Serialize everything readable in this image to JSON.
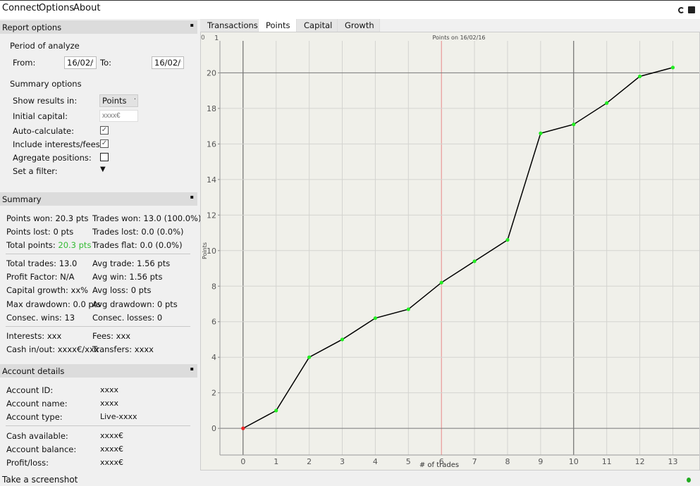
{
  "menu": {
    "connect": "Connect",
    "options": "Options",
    "about": "About",
    "icons": [
      "refresh-icon",
      "camera-icon"
    ]
  },
  "report": {
    "title": "Report options",
    "period": "Period of analyze",
    "from_label": "From:",
    "from_value": "16/02/",
    "to_label": "To:",
    "to_value": "16/02/",
    "summary_options": "Summary options",
    "show_results_label": "Show results in:",
    "show_results_value": "Points",
    "initial_capital_label": "Initial capital:",
    "initial_capital_placeholder": "xxxx€",
    "auto_calc_label": "Auto-calculate:",
    "auto_calc": true,
    "include_fees_label": "Include interests/fees:",
    "include_fees": true,
    "aggregate_label": "Agregate positions:",
    "aggregate": false,
    "filter_label": "Set a filter:"
  },
  "summary": {
    "title": "Summary",
    "points_won_label": "Points won:",
    "points_won": "20.3 pts",
    "trades_won": "Trades won: 13.0 (100.0%)",
    "points_lost": "Points lost: 0 pts",
    "trades_lost": "Trades lost: 0.0 (0.0%)",
    "total_points_label": "Total points:",
    "total_points": "20.3 pts",
    "trades_flat": "Trades flat: 0.0 (0.0%)",
    "total_trades": "Total trades: 13.0",
    "avg_trade": "Avg trade: 1.56 pts",
    "profit_factor": "Profit Factor: N/A",
    "avg_win": "Avg win: 1.56 pts",
    "capital_growth": "Capital growth: xx%",
    "avg_loss": "Avg loss: 0 pts",
    "max_drawdown": "Max drawdown: 0.0 pts",
    "avg_drawdown": "Avg drawdown: 0 pts",
    "consec_wins": "Consec. wins: 13",
    "consec_losses": "Consec. losses: 0",
    "interests": "Interests: xxx",
    "fees": "Fees: xxx",
    "cash_inout": "Cash in/out: xxxx€/xxx",
    "transfers": "Transfers: xxxx",
    "positive_color": "#33bb33"
  },
  "account": {
    "title": "Account details",
    "rows": [
      {
        "label": "Account ID:",
        "value": "xxxx"
      },
      {
        "label": "Account name:",
        "value": "xxxx"
      },
      {
        "label": "Account type:",
        "value": "Live-xxxx"
      },
      {
        "label": "Cash available:",
        "value": "xxxx€"
      },
      {
        "label": "Account balance:",
        "value": "xxxx€"
      },
      {
        "label": "Profit/loss:",
        "value": "xxxx€"
      }
    ]
  },
  "tabs": [
    {
      "label": "Transactions"
    },
    {
      "label": "Points",
      "active": true
    },
    {
      "label": "Capital"
    },
    {
      "label": "Growth"
    }
  ],
  "status": {
    "text": "Take a screenshot",
    "indicator_color": "#22aa22"
  },
  "chart_data": {
    "type": "line",
    "title": "Points on 16/02/16",
    "xlabel": "# of trades",
    "ylabel": "Points",
    "corner_labels": [
      "0",
      "1"
    ],
    "x": [
      0,
      1,
      2,
      3,
      4,
      5,
      6,
      7,
      8,
      9,
      10,
      11,
      12,
      13
    ],
    "values": [
      0,
      1.0,
      4.0,
      5.0,
      6.2,
      6.7,
      8.2,
      9.4,
      10.6,
      16.6,
      17.1,
      18.3,
      19.8,
      20.3
    ],
    "xticks": [
      0,
      1,
      2,
      3,
      4,
      5,
      6,
      7,
      8,
      9,
      10,
      11,
      12,
      13
    ],
    "yticks": [
      0,
      2,
      4,
      6,
      8,
      10,
      12,
      14,
      16,
      18,
      20
    ],
    "xlim": [
      -0.7,
      13.8
    ],
    "ylim": [
      -1.5,
      21.8
    ],
    "grid": true,
    "highlight_x": 6,
    "line_color": "#000000",
    "point_color": "#22ee22",
    "first_point_color": "#ee2222",
    "highlight_color": "#e88888"
  }
}
